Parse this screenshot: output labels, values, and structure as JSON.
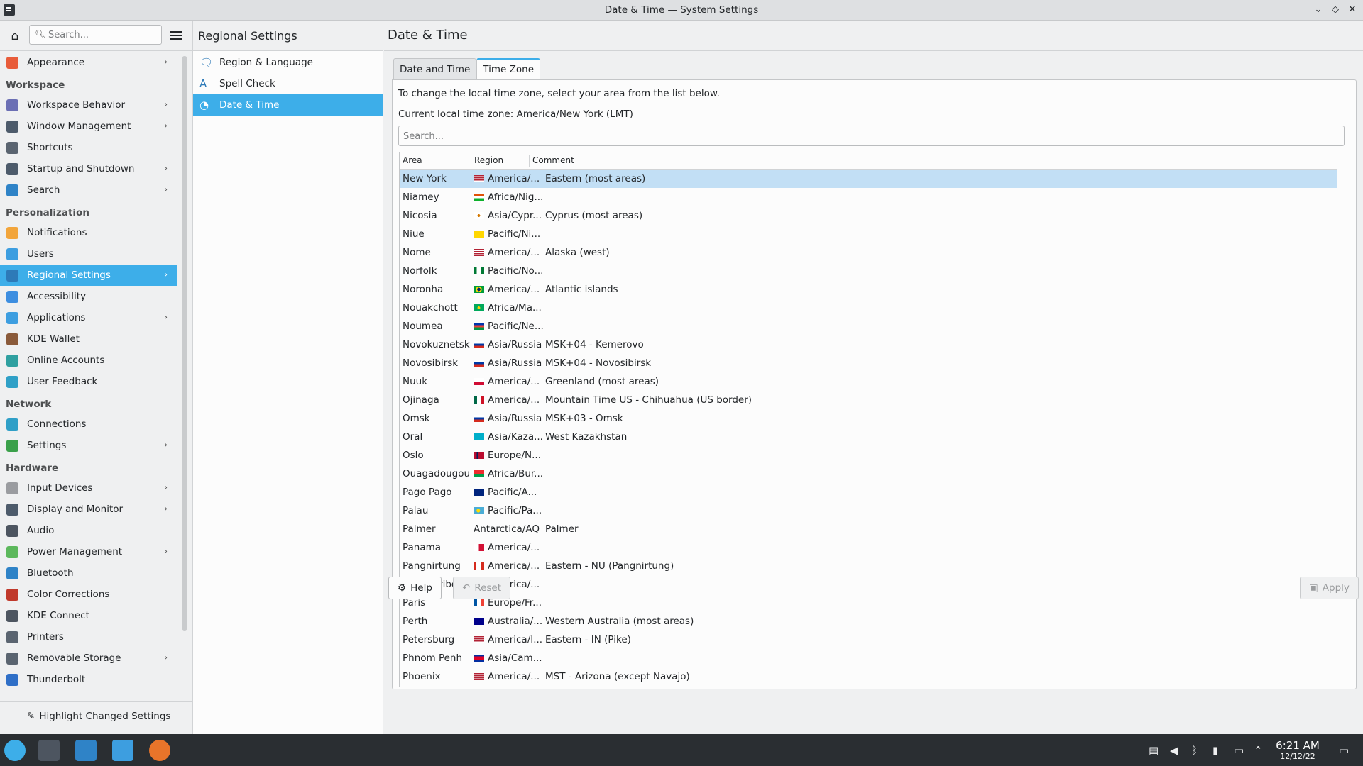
{
  "window": {
    "title": "Date & Time — System Settings"
  },
  "sidebar": {
    "search_placeholder": "Search...",
    "groups": [
      {
        "header": "",
        "items": [
          {
            "label": "Appearance",
            "icon": "appearance-icon",
            "color": "#e85c3a",
            "chevron": true
          }
        ]
      },
      {
        "header": "Workspace",
        "items": [
          {
            "label": "Workspace Behavior",
            "icon": "workspace-behavior-icon",
            "color": "#6b6fb4",
            "chevron": true
          },
          {
            "label": "Window Management",
            "icon": "window-management-icon",
            "color": "#4d5b6b",
            "chevron": true
          },
          {
            "label": "Shortcuts",
            "icon": "shortcuts-icon",
            "color": "#5a6470",
            "chevron": false
          },
          {
            "label": "Startup and Shutdown",
            "icon": "startup-shutdown-icon",
            "color": "#4d5b6b",
            "chevron": true
          },
          {
            "label": "Search",
            "icon": "search-icon",
            "color": "#2f83c7",
            "chevron": true
          }
        ]
      },
      {
        "header": "Personalization",
        "items": [
          {
            "label": "Notifications",
            "icon": "bell-icon",
            "color": "#f2a53b",
            "chevron": false
          },
          {
            "label": "Users",
            "icon": "users-icon",
            "color": "#3d9ee0",
            "chevron": false
          },
          {
            "label": "Regional Settings",
            "icon": "regional-settings-icon",
            "color": "#2d7ab8",
            "chevron": true,
            "active": true
          },
          {
            "label": "Accessibility",
            "icon": "accessibility-icon",
            "color": "#3d8ee0",
            "chevron": false
          },
          {
            "label": "Applications",
            "icon": "applications-icon",
            "color": "#3d9ee0",
            "chevron": true
          },
          {
            "label": "KDE Wallet",
            "icon": "wallet-icon",
            "color": "#8a5a3a",
            "chevron": false
          },
          {
            "label": "Online Accounts",
            "icon": "online-accounts-icon",
            "color": "#2fa0a0",
            "chevron": false
          },
          {
            "label": "User Feedback",
            "icon": "feedback-icon",
            "color": "#2fa0c7",
            "chevron": false
          }
        ]
      },
      {
        "header": "Network",
        "items": [
          {
            "label": "Connections",
            "icon": "connections-icon",
            "color": "#2f9fc7",
            "chevron": false
          },
          {
            "label": "Settings",
            "icon": "network-settings-icon",
            "color": "#3aa04a",
            "chevron": true
          }
        ]
      },
      {
        "header": "Hardware",
        "items": [
          {
            "label": "Input Devices",
            "icon": "mouse-icon",
            "color": "#9a9ca0",
            "chevron": true
          },
          {
            "label": "Display and Monitor",
            "icon": "monitor-icon",
            "color": "#4d5b6b",
            "chevron": true
          },
          {
            "label": "Audio",
            "icon": "audio-icon",
            "color": "#4d5560",
            "chevron": false
          },
          {
            "label": "Power Management",
            "icon": "power-icon",
            "color": "#5cb85c",
            "chevron": true
          },
          {
            "label": "Bluetooth",
            "icon": "bluetooth-icon",
            "color": "#2f83c7",
            "chevron": false
          },
          {
            "label": "Color Corrections",
            "icon": "color-corrections-icon",
            "color": "#c0392b",
            "chevron": false
          },
          {
            "label": "KDE Connect",
            "icon": "phone-icon",
            "color": "#4d5560",
            "chevron": false
          },
          {
            "label": "Printers",
            "icon": "printer-icon",
            "color": "#5a6470",
            "chevron": false
          },
          {
            "label": "Removable Storage",
            "icon": "storage-icon",
            "color": "#5a6470",
            "chevron": true
          },
          {
            "label": "Thunderbolt",
            "icon": "thunderbolt-icon",
            "color": "#2f6fc7",
            "chevron": false
          }
        ]
      }
    ],
    "highlight_button": "Highlight Changed Settings"
  },
  "middle": {
    "title": "Regional Settings",
    "items": [
      {
        "label": "Region & Language",
        "icon": "region-language-icon"
      },
      {
        "label": "Spell Check",
        "icon": "spell-check-icon"
      },
      {
        "label": "Date & Time",
        "icon": "clock-icon",
        "active": true
      }
    ]
  },
  "main": {
    "title": "Date & Time",
    "tabs": [
      {
        "label": "Date and Time",
        "active": false
      },
      {
        "label": "Time Zone",
        "active": true
      }
    ],
    "instruction": "To change the local time zone, select your area from the list below.",
    "current_zone": "Current local time zone: America/New York (LMT)",
    "search_placeholder": "Search...",
    "columns": [
      "Area",
      "Region",
      "Comment"
    ],
    "rows": [
      {
        "area": "New York",
        "region": "America/...",
        "comment": "Eastern (most areas)",
        "flag": "us",
        "selected": true
      },
      {
        "area": "Niamey",
        "region": "Africa/Nig...",
        "comment": "",
        "flag": "ne"
      },
      {
        "area": "Nicosia",
        "region": "Asia/Cypr...",
        "comment": "Cyprus (most areas)",
        "flag": "cy"
      },
      {
        "area": "Niue",
        "region": "Pacific/Ni...",
        "comment": "",
        "flag": "nu"
      },
      {
        "area": "Nome",
        "region": "America/...",
        "comment": "Alaska (west)",
        "flag": "us"
      },
      {
        "area": "Norfolk",
        "region": "Pacific/No...",
        "comment": "",
        "flag": "nf"
      },
      {
        "area": "Noronha",
        "region": "America/...",
        "comment": "Atlantic islands",
        "flag": "br"
      },
      {
        "area": "Nouakchott",
        "region": "Africa/Ma...",
        "comment": "",
        "flag": "mr"
      },
      {
        "area": "Noumea",
        "region": "Pacific/Ne...",
        "comment": "",
        "flag": "nc"
      },
      {
        "area": "Novokuznetsk",
        "region": "Asia/Russia",
        "comment": "MSK+04 - Kemerovo",
        "flag": "ru"
      },
      {
        "area": "Novosibirsk",
        "region": "Asia/Russia",
        "comment": "MSK+04 - Novosibirsk",
        "flag": "ru"
      },
      {
        "area": "Nuuk",
        "region": "America/...",
        "comment": "Greenland (most areas)",
        "flag": "gl"
      },
      {
        "area": "Ojinaga",
        "region": "America/...",
        "comment": "Mountain Time US - Chihuahua (US border)",
        "flag": "mx"
      },
      {
        "area": "Omsk",
        "region": "Asia/Russia",
        "comment": "MSK+03 - Omsk",
        "flag": "ru"
      },
      {
        "area": "Oral",
        "region": "Asia/Kaza...",
        "comment": "West Kazakhstan",
        "flag": "kz"
      },
      {
        "area": "Oslo",
        "region": "Europe/N...",
        "comment": "",
        "flag": "no"
      },
      {
        "area": "Ouagadougou",
        "region": "Africa/Bur...",
        "comment": "",
        "flag": "bf"
      },
      {
        "area": "Pago Pago",
        "region": "Pacific/A...",
        "comment": "",
        "flag": "as"
      },
      {
        "area": "Palau",
        "region": "Pacific/Pa...",
        "comment": "",
        "flag": "pw"
      },
      {
        "area": "Palmer",
        "region": "Antarctica/AQ",
        "comment": "Palmer",
        "flag": ""
      },
      {
        "area": "Panama",
        "region": "America/...",
        "comment": "",
        "flag": "pa"
      },
      {
        "area": "Pangnirtung",
        "region": "America/...",
        "comment": "Eastern - NU (Pangnirtung)",
        "flag": "ca"
      },
      {
        "area": "Paramaribo",
        "region": "America/...",
        "comment": "",
        "flag": "sr"
      },
      {
        "area": "Paris",
        "region": "Europe/Fr...",
        "comment": "",
        "flag": "fr"
      },
      {
        "area": "Perth",
        "region": "Australia/...",
        "comment": "Western Australia (most areas)",
        "flag": "au"
      },
      {
        "area": "Petersburg",
        "region": "America/I...",
        "comment": "Eastern - IN (Pike)",
        "flag": "us"
      },
      {
        "area": "Phnom Penh",
        "region": "Asia/Cam...",
        "comment": "",
        "flag": "kh"
      },
      {
        "area": "Phoenix",
        "region": "America/...",
        "comment": "MST - Arizona (except Navajo)",
        "flag": "us"
      }
    ],
    "help_button": "Help",
    "reset_button": "Reset",
    "apply_button": "Apply"
  },
  "taskbar": {
    "time": "6:21 AM",
    "date": "12/12/22"
  },
  "colors": {
    "accent": "#3daee9",
    "selection": "#c2dff5"
  }
}
